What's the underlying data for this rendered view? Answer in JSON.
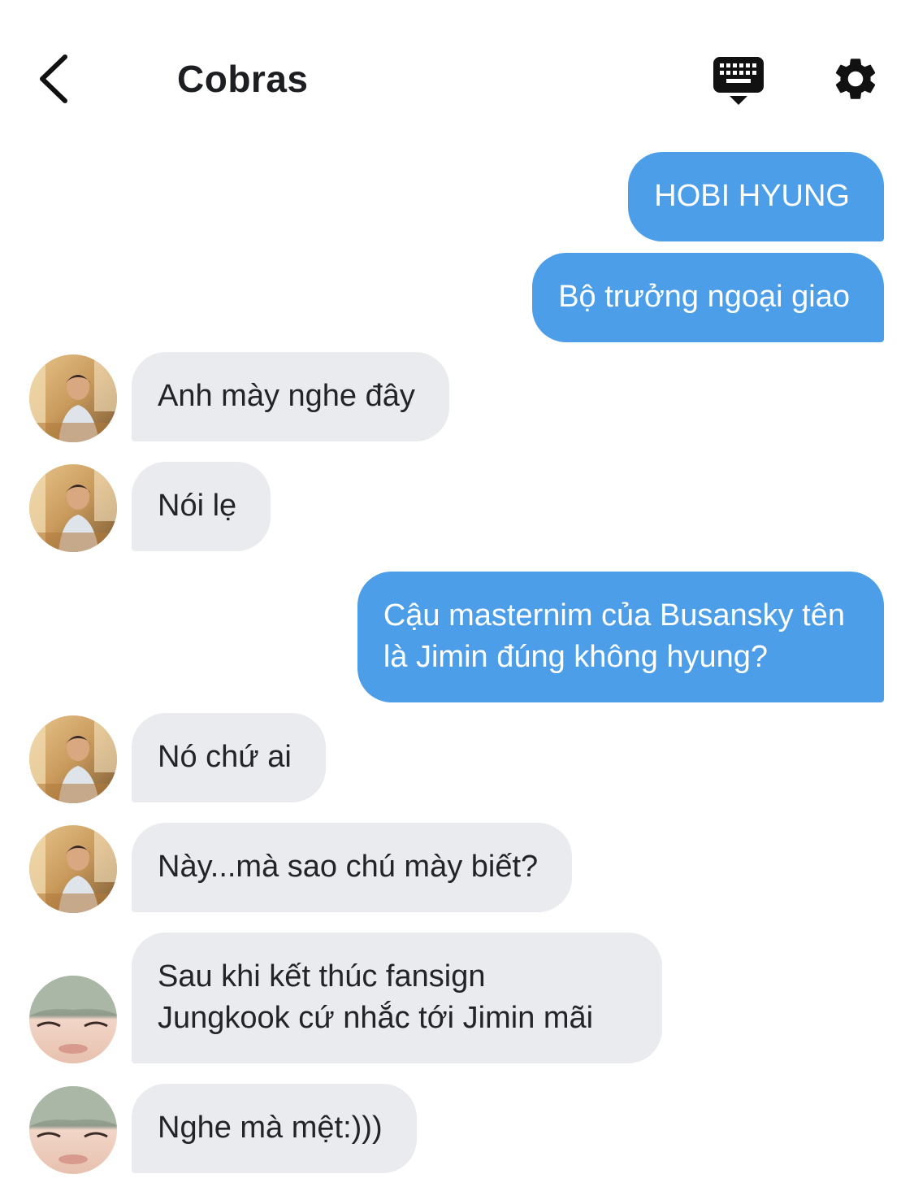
{
  "header": {
    "title": "Cobras",
    "back_icon": "chevron-left-icon",
    "keyboard_icon": "keyboard-icon",
    "settings_icon": "gear-icon"
  },
  "colors": {
    "outgoing_bubble": "#4c9ee8",
    "incoming_bubble": "#e9ebef",
    "text": "#1c1e21"
  },
  "messages": [
    {
      "direction": "out",
      "lines": [
        "HOBI HYUNG"
      ]
    },
    {
      "direction": "out",
      "lines": [
        "Bộ trưởng ngoại giao"
      ]
    },
    {
      "direction": "in",
      "avatar": "avatar-1",
      "lines": [
        "Anh mày nghe đây"
      ]
    },
    {
      "direction": "in",
      "avatar": "avatar-1",
      "lines": [
        "Nói lẹ"
      ]
    },
    {
      "direction": "out",
      "lines": [
        "Cậu masternim của Busansky tên",
        "là Jimin đúng không hyung?"
      ]
    },
    {
      "direction": "in",
      "avatar": "avatar-1",
      "lines": [
        "Nó chứ ai"
      ]
    },
    {
      "direction": "in",
      "avatar": "avatar-1",
      "lines": [
        "Này...mà sao chú mày biết?"
      ]
    },
    {
      "direction": "in",
      "avatar": "avatar-2",
      "lines": [
        "Sau khi kết thúc fansign",
        "Jungkook cứ nhắc tới Jimin mãi"
      ]
    },
    {
      "direction": "in",
      "avatar": "avatar-2",
      "lines": [
        "Nghe mà mệt:)))"
      ]
    }
  ]
}
